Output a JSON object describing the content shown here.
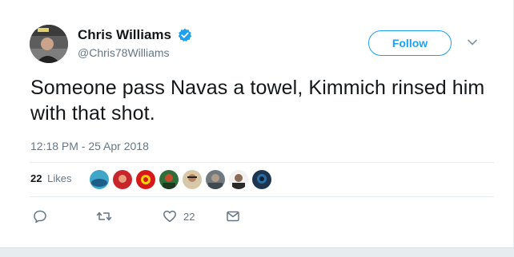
{
  "author": {
    "display_name": "Chris Williams",
    "handle": "@Chris78Williams",
    "verified": true
  },
  "follow_button": {
    "label": "Follow"
  },
  "tweet": {
    "text": "Someone pass Navas a towel, Kimmich rinsed him with that shot.",
    "timestamp": "12:18 PM - 25 Apr 2018"
  },
  "stats": {
    "likes_count": "22",
    "likes_label": "Likes"
  },
  "likers": [
    {
      "name": "liker-avatar-1",
      "color": "#3fa6c9"
    },
    {
      "name": "liker-avatar-2",
      "color": "#c8262c"
    },
    {
      "name": "liker-avatar-3",
      "color": "#d61a1a"
    },
    {
      "name": "liker-avatar-4",
      "color": "#2f6e3a"
    },
    {
      "name": "liker-avatar-5",
      "color": "#d8c7a8"
    },
    {
      "name": "liker-avatar-6",
      "color": "#6f7a80"
    },
    {
      "name": "liker-avatar-7",
      "color": "#f2f2f2"
    },
    {
      "name": "liker-avatar-8",
      "color": "#1e3550"
    }
  ],
  "actions": {
    "reply_icon": "reply-icon",
    "retweet_icon": "retweet-icon",
    "like_icon": "heart-icon",
    "like_count": "22",
    "message_icon": "envelope-icon"
  },
  "colors": {
    "accent": "#1da1f2",
    "muted_text": "#657786",
    "text": "#14171a"
  }
}
